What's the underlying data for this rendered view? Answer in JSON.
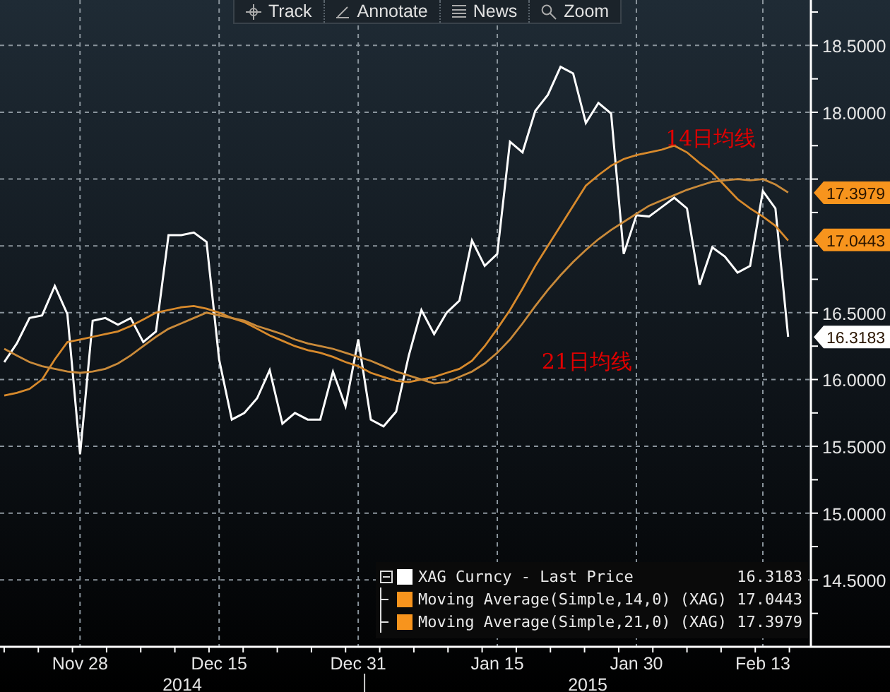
{
  "toolbar": {
    "buttons": [
      {
        "kind": "track",
        "label": "Track"
      },
      {
        "kind": "annotate",
        "label": "Annotate"
      },
      {
        "kind": "news",
        "label": "News"
      },
      {
        "kind": "zoom",
        "label": "Zoom"
      }
    ]
  },
  "chart": {
    "chart_data": {
      "type": "line",
      "categories": [
        null,
        null,
        null,
        null,
        null,
        null,
        "Nov 28",
        null,
        null,
        null,
        null,
        null,
        null,
        null,
        null,
        null,
        null,
        "Dec 15",
        null,
        null,
        null,
        null,
        null,
        null,
        null,
        null,
        null,
        null,
        "Dec 31",
        null,
        null,
        null,
        null,
        null,
        null,
        null,
        null,
        null,
        null,
        "Jan 15",
        null,
        null,
        null,
        null,
        null,
        null,
        null,
        null,
        null,
        null,
        "Jan 30",
        null,
        null,
        null,
        null,
        null,
        null,
        null,
        null,
        null,
        "Feb 13",
        null,
        null
      ],
      "series": [
        {
          "name": "XAG Curncy - Last Price",
          "color": "#ffffff",
          "values": [
            16.13,
            16.27,
            16.46,
            16.48,
            16.7,
            16.49,
            15.44,
            16.44,
            16.46,
            16.41,
            16.46,
            16.28,
            16.36,
            17.08,
            17.08,
            17.1,
            17.03,
            16.15,
            15.7,
            15.75,
            15.86,
            16.07,
            15.67,
            15.75,
            15.7,
            15.7,
            16.06,
            15.8,
            16.3,
            15.7,
            15.65,
            15.76,
            16.18,
            16.52,
            16.34,
            16.5,
            16.59,
            17.04,
            16.85,
            16.94,
            17.78,
            17.7,
            18.01,
            18.13,
            18.34,
            18.29,
            17.92,
            18.07,
            17.99,
            16.94,
            17.23,
            17.22,
            17.29,
            17.36,
            17.28,
            16.71,
            16.99,
            16.92,
            16.8,
            16.85,
            17.41,
            17.28,
            16.32
          ]
        },
        {
          "name": "Moving Average(Simple,14,0) (XAG)",
          "color": "#d88a2c",
          "values": [
            15.88,
            15.9,
            15.93,
            16.0,
            16.15,
            16.28,
            16.3,
            16.32,
            16.34,
            16.36,
            16.4,
            16.45,
            16.5,
            16.52,
            16.54,
            16.55,
            16.53,
            16.5,
            16.46,
            16.43,
            16.38,
            16.33,
            16.29,
            16.25,
            16.22,
            16.2,
            16.17,
            16.13,
            16.1,
            16.05,
            16.02,
            15.99,
            15.98,
            16.0,
            16.02,
            16.05,
            16.08,
            16.14,
            16.25,
            16.38,
            16.52,
            16.68,
            16.85,
            17.0,
            17.15,
            17.3,
            17.45,
            17.53,
            17.6,
            17.65,
            17.68,
            17.7,
            17.72,
            17.75,
            17.7,
            17.62,
            17.55,
            17.45,
            17.35,
            17.28,
            17.22,
            17.15,
            17.04
          ]
        },
        {
          "name": "Moving Average(Simple,21,0) (XAG)",
          "color": "#c98a3a",
          "values": [
            16.23,
            16.18,
            16.13,
            16.1,
            16.08,
            16.06,
            16.05,
            16.06,
            16.08,
            16.12,
            16.18,
            16.25,
            16.32,
            16.38,
            16.42,
            16.46,
            16.5,
            16.48,
            16.46,
            16.44,
            16.4,
            16.37,
            16.34,
            16.3,
            16.27,
            16.25,
            16.23,
            16.2,
            16.17,
            16.14,
            16.1,
            16.06,
            16.03,
            16.0,
            15.97,
            15.98,
            16.02,
            16.06,
            16.12,
            16.2,
            16.3,
            16.42,
            16.55,
            16.67,
            16.78,
            16.88,
            16.97,
            17.05,
            17.12,
            17.18,
            17.24,
            17.3,
            17.34,
            17.38,
            17.42,
            17.45,
            17.48,
            17.49,
            17.5,
            17.49,
            17.5,
            17.46,
            17.4
          ]
        }
      ],
      "ylim": [
        14.0,
        18.84
      ],
      "grid": true,
      "yticks": [
        {
          "value": 18.5,
          "label": "18.5000"
        },
        {
          "value": 18.0,
          "label": "18.0000"
        },
        {
          "value": 16.5,
          "label": "16.5000"
        },
        {
          "value": 16.0,
          "label": "16.0000"
        },
        {
          "value": 15.5,
          "label": "15.5000"
        },
        {
          "value": 15.0,
          "label": "15.0000"
        },
        {
          "value": 14.5,
          "label": "14.5000"
        }
      ],
      "annotations": [
        "14日均线",
        "21日均线"
      ]
    },
    "years": [
      {
        "label": "2014"
      },
      {
        "label": "2015"
      }
    ],
    "price_tags": [
      {
        "text": "17.3979",
        "color": "#f7941d"
      },
      {
        "text": "17.0443",
        "color": "#f7941d"
      },
      {
        "text": "16.3183",
        "color": "#ffffff"
      }
    ]
  },
  "legend": {
    "items": [
      {
        "value": "16.3183",
        "color": "#ffffff"
      },
      {
        "value": "17.0443",
        "color": "#f7941d"
      },
      {
        "value": "17.3979",
        "color": "#f7941d"
      }
    ]
  }
}
